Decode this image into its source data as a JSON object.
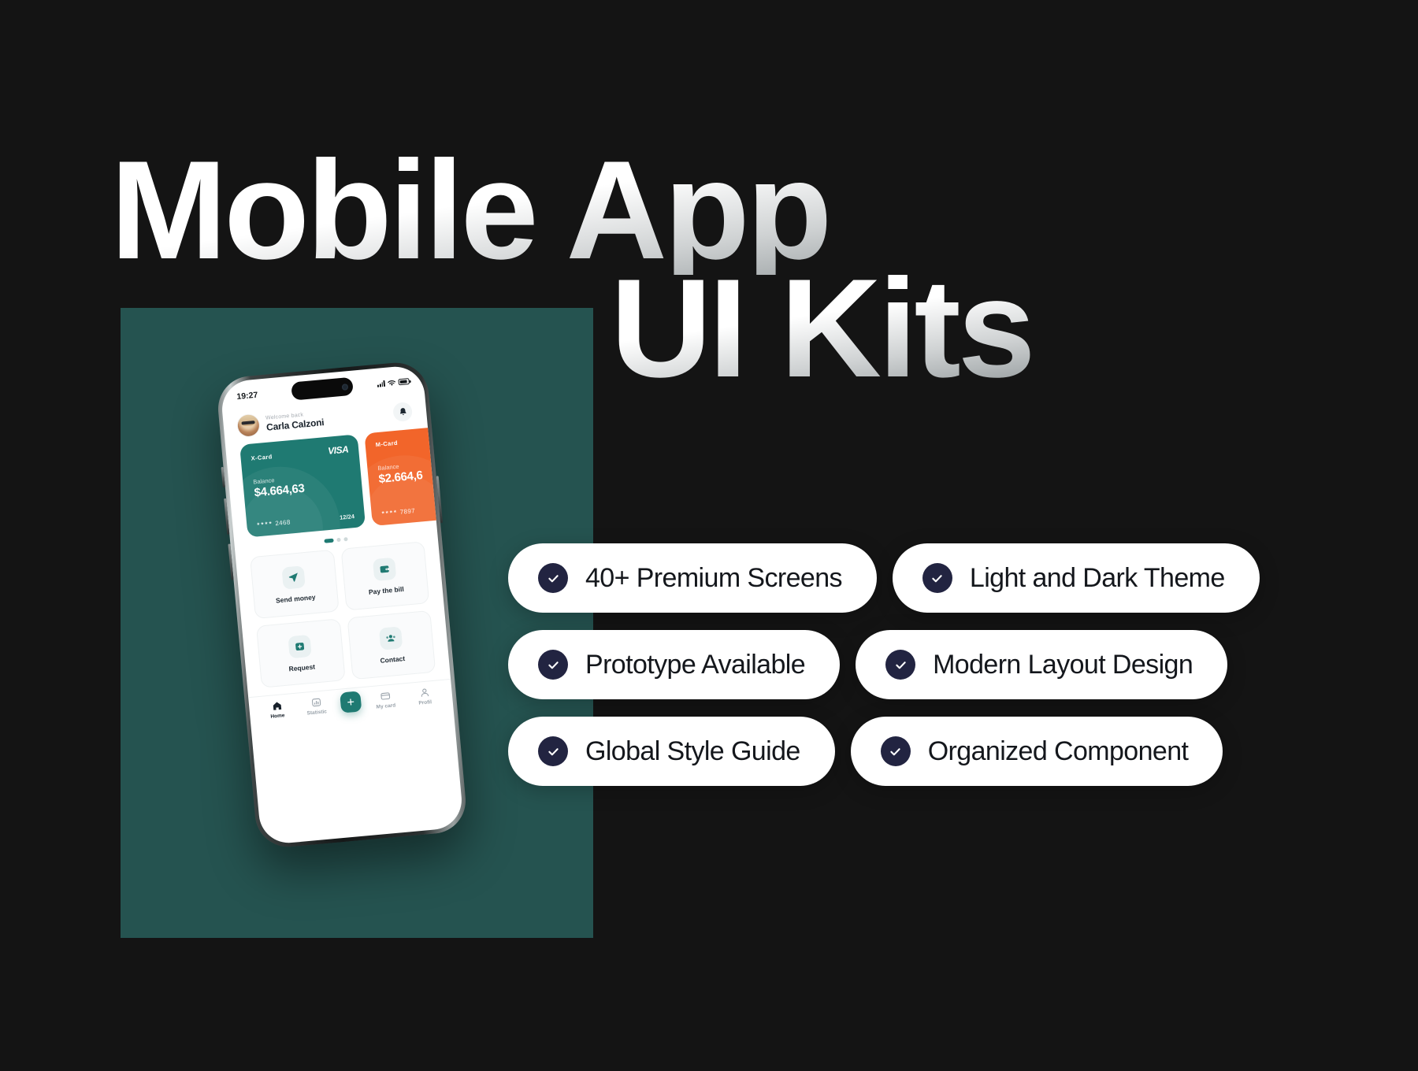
{
  "headline": {
    "line1": "Mobile App",
    "line2": "UI Kits"
  },
  "colors": {
    "background": "#141414",
    "panel_teal": "#255350",
    "card_teal": "#1f7a72",
    "card_orange": "#f2652a",
    "check_navy": "#222441",
    "pill_white": "#ffffff"
  },
  "features": [
    {
      "label": "40+ Premium Screens",
      "icon": "check-circle-icon"
    },
    {
      "label": "Light and Dark Theme",
      "icon": "check-circle-icon"
    },
    {
      "label": "Prototype Available",
      "icon": "check-circle-icon"
    },
    {
      "label": "Modern Layout Design",
      "icon": "check-circle-icon"
    },
    {
      "label": "Global Style Guide",
      "icon": "check-circle-icon"
    },
    {
      "label": "Organized Component",
      "icon": "check-circle-icon"
    }
  ],
  "phone": {
    "status_bar": {
      "time": "19:27",
      "signal_icon": "cellular-bars-icon",
      "wifi_icon": "wifi-icon",
      "battery_icon": "battery-icon"
    },
    "header": {
      "greeting_label": "Welcome back",
      "user_name": "Carla Calzoni",
      "avatar": "user-avatar",
      "notification_icon": "bell-icon"
    },
    "cards": [
      {
        "name": "X-Card",
        "brand": "VISA",
        "balance_label": "Balance",
        "balance": "$4.664,63",
        "masked": "****",
        "last4": "2468",
        "expiry": "12/24",
        "color": "#1f7a72"
      },
      {
        "name": "M-Card",
        "brand": "",
        "balance_label": "Balance",
        "balance": "$2.664,6",
        "masked": "****",
        "last4": "7897",
        "expiry": "",
        "color": "#f2652a"
      }
    ],
    "carousel_dots": {
      "total": 3,
      "active_index": 0
    },
    "actions": [
      {
        "label": "Send money",
        "icon": "send-plane-icon"
      },
      {
        "label": "Pay the bill",
        "icon": "wallet-icon"
      },
      {
        "label": "Request",
        "icon": "request-card-icon"
      },
      {
        "label": "Contact",
        "icon": "contacts-icon"
      }
    ],
    "bottom_nav": {
      "items": [
        {
          "label": "Home",
          "icon": "home-icon",
          "active": true
        },
        {
          "label": "Statistic",
          "icon": "chart-bar-icon",
          "active": false
        },
        {
          "label": "My card",
          "icon": "credit-card-icon",
          "active": false
        },
        {
          "label": "Profil",
          "icon": "person-icon",
          "active": false
        }
      ],
      "fab": {
        "icon": "plus-icon"
      }
    }
  }
}
